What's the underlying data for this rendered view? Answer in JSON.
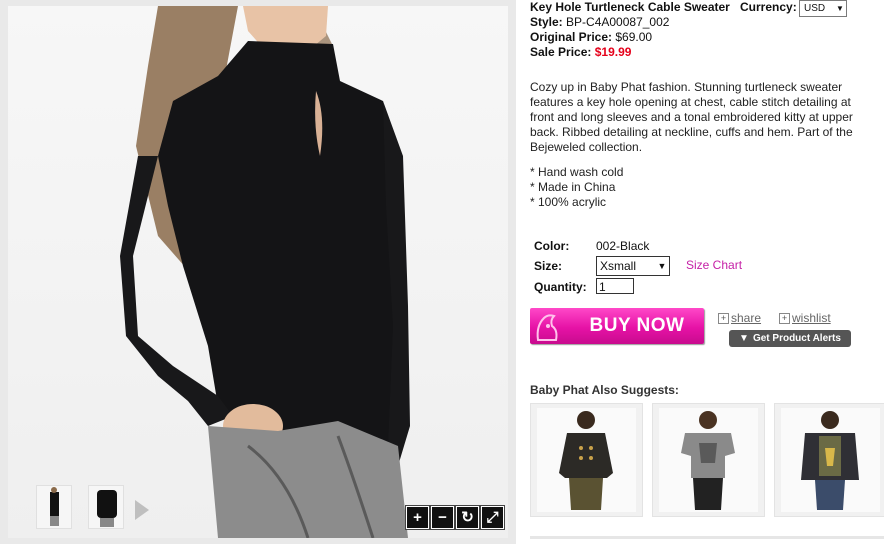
{
  "product": {
    "title": "Key Hole Turtleneck Cable Sweater",
    "style_label": "Style:",
    "style_value": "BP-C4A00087_002",
    "original_label": "Original Price:",
    "original_value": "$69.00",
    "sale_label": "Sale Price:",
    "sale_value": "$19.99",
    "description": "Cozy up in Baby Phat fashion. Stunning turtleneck sweater features a key hole opening at chest, cable stitch detailing at front and long sleeves and a tonal embroidered kitty at upper back. Ribbed detailing at neckline, cuffs and hem. Part of the Bejeweled collection.",
    "bullets": [
      "* Hand wash cold",
      "* Made in China",
      "* 100% acrylic"
    ]
  },
  "currency": {
    "label": "Currency:",
    "selected": "USD"
  },
  "options": {
    "color_label": "Color:",
    "color_value": "002-Black",
    "size_label": "Size:",
    "size_selected": "Xsmall",
    "size_chart_link": "Size Chart",
    "quantity_label": "Quantity:",
    "quantity_value": "1"
  },
  "actions": {
    "buy_now": "BUY NOW",
    "share": "share",
    "wishlist": "wishlist",
    "alerts": "Get Product Alerts"
  },
  "gallery": {
    "zoom_in": "+",
    "zoom_out": "−",
    "rotate": "↻",
    "fullscreen": "⤢"
  },
  "suggestions": {
    "title": "Baby Phat Also Suggests:"
  }
}
